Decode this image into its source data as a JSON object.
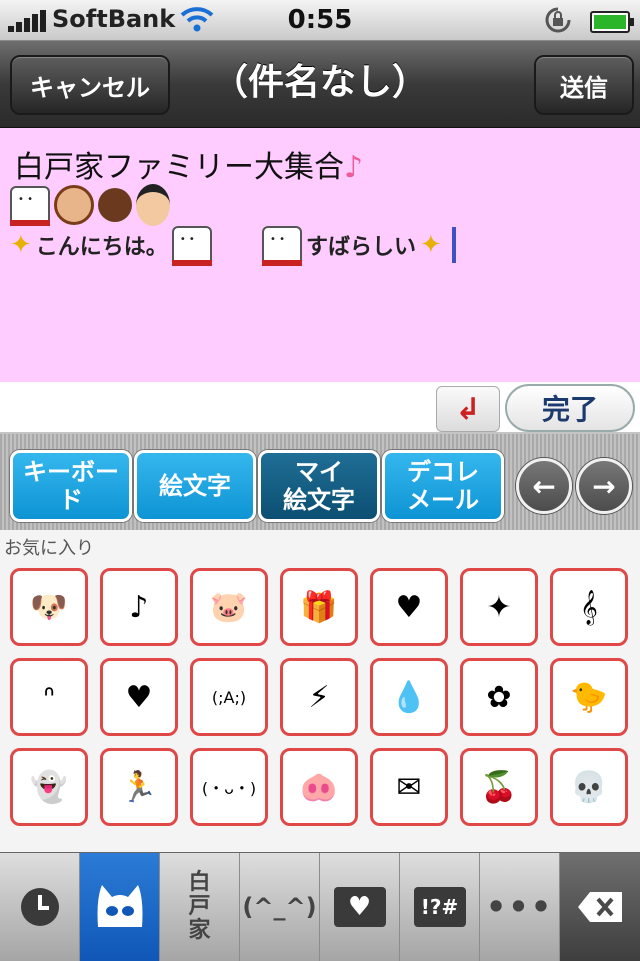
{
  "status_bar": {
    "carrier": "SoftBank",
    "time": "0:55"
  },
  "nav_bar": {
    "cancel_label": "キャンセル",
    "title": "（件名なし）",
    "send_label": "送信"
  },
  "message": {
    "subject": "白戸家ファミリー大集合",
    "greeting": "こんにちは。",
    "praise": "すばらしい"
  },
  "input_toolbar": {
    "return_icon": "↲",
    "done_label": "完了"
  },
  "tabs": [
    {
      "label": "キーボード",
      "selected": false
    },
    {
      "label": "絵文字",
      "selected": false
    },
    {
      "label": "マイ\n絵文字",
      "selected": true
    },
    {
      "label": "デコレ\nメール",
      "selected": false
    }
  ],
  "nav_arrows": {
    "prev": "←",
    "next": "→"
  },
  "favorites": {
    "label": "お気に入り",
    "items": [
      {
        "name": "white-dog-emoji",
        "glyph": "🐶"
      },
      {
        "name": "pink-note-emoji",
        "glyph": "♪"
      },
      {
        "name": "pig-emoji",
        "glyph": "🐷"
      },
      {
        "name": "gift-emoji",
        "glyph": "🎁"
      },
      {
        "name": "rainbow-heart-emoji",
        "glyph": "♥"
      },
      {
        "name": "sparkle-emoji",
        "glyph": "✦"
      },
      {
        "name": "g-clef-emoji",
        "glyph": "𝄞"
      },
      {
        "name": "sad-stick-figure-emoji",
        "glyph": "ᐢ"
      },
      {
        "name": "heart-text-emoji",
        "glyph": "♥"
      },
      {
        "name": "kaomoji-cry-emoji",
        "glyph": "(;A;)"
      },
      {
        "name": "lightning-emoji",
        "glyph": "⚡"
      },
      {
        "name": "blue-drops-emoji",
        "glyph": "💧"
      },
      {
        "name": "pink-flower-emoji",
        "glyph": "✿"
      },
      {
        "name": "chick-emoji",
        "glyph": "🐤"
      },
      {
        "name": "ghost-emoji",
        "glyph": "👻"
      },
      {
        "name": "stick-figure-emoji",
        "glyph": "🏃"
      },
      {
        "name": "kaomoji-smile-emoji",
        "glyph": "(・ᴗ・)"
      },
      {
        "name": "pig-face-emoji",
        "glyph": "🐽"
      },
      {
        "name": "envelope-emoji",
        "glyph": "✉"
      },
      {
        "name": "cherries-emoji",
        "glyph": "🍒"
      },
      {
        "name": "skull-emoji",
        "glyph": "💀"
      }
    ]
  },
  "bottom_bar": {
    "history_icon": "clock-icon",
    "cat_icon": "cat-icon",
    "category_shiroto": "白\n戸\n家",
    "kaomoji": "(^_^)",
    "heart_icon": "heart-icon",
    "symbols": "!?#",
    "more": "•••",
    "delete_icon": "backspace-icon"
  }
}
